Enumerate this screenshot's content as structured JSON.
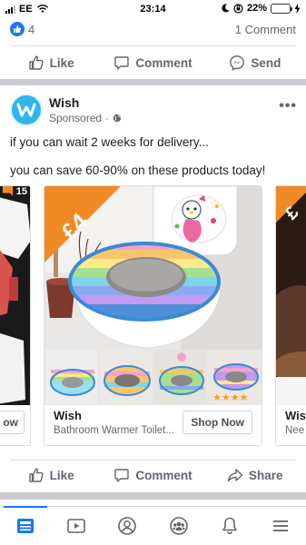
{
  "status_bar": {
    "carrier": "EE",
    "time": "23:14",
    "battery": "22%",
    "battery_level": 0.22
  },
  "previous_post": {
    "like_count": "4",
    "comment_count": "1 Comment",
    "actions": {
      "like": "Like",
      "comment": "Comment",
      "send": "Send"
    }
  },
  "post": {
    "page_name": "Wish",
    "sponsored": "Sponsored",
    "text_line1": "if you can wait 2 weeks for delivery...",
    "text_line2": "you can save 60-90% on these products today!",
    "carousel": [
      {
        "price": "15",
        "title": "",
        "description": "",
        "button": "ow"
      },
      {
        "price": "£4",
        "title": "Wish",
        "description": "Bathroom Warmer Toilet...",
        "button": "Shop Now"
      },
      {
        "price": "£",
        "title": "Wis",
        "description": "Nee",
        "button": ""
      }
    ],
    "actions": {
      "like": "Like",
      "comment": "Comment",
      "share": "Share"
    }
  },
  "colors": {
    "brand": "#1877f2",
    "wish": "#2fb7ec",
    "tag": "#f08a24"
  },
  "tabbar": [
    "news-feed-icon",
    "watch-icon",
    "profile-icon",
    "groups-icon",
    "notifications-icon",
    "menu-icon"
  ]
}
